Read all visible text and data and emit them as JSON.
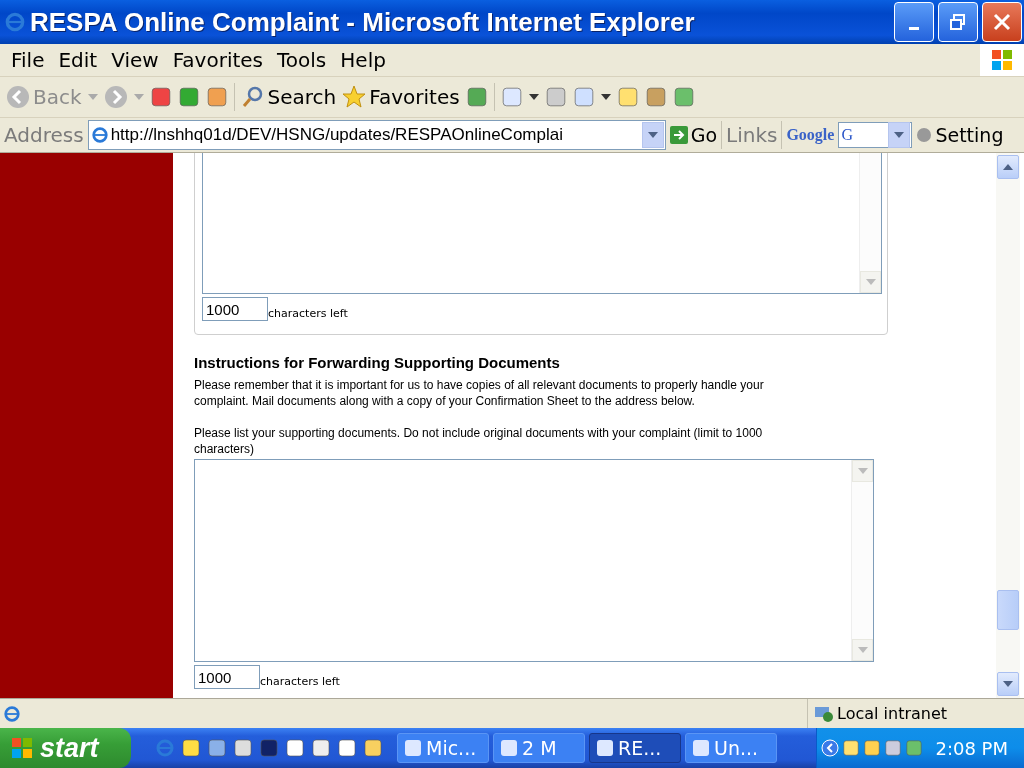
{
  "window": {
    "title": "RESPA Online Complaint - Microsoft Internet Explorer"
  },
  "menu": [
    "File",
    "Edit",
    "View",
    "Favorites",
    "Tools",
    "Help"
  ],
  "toolbar": {
    "back": "Back",
    "back_disabled": true,
    "search": "Search",
    "favorites": "Favorites"
  },
  "address": {
    "label": "Address",
    "value": "http://lnshhq01d/DEV/HSNG/updates/RESPAOnlineComplai",
    "go": "Go",
    "links": "Links",
    "google": "Google",
    "google_box": "G",
    "settings": "Setting"
  },
  "form": {
    "first_counter": {
      "value": "1000",
      "label": "characters left"
    },
    "heading": "Instructions for Forwarding Supporting Documents",
    "paragraphs": [
      "Please remember that it is important for us to have copies of all relevant documents to properly handle your complaint. Mail documents along with a copy of your Confirmation Sheet to the address below.",
      "Please list your supporting documents. Do not include original documents with your complaint (limit to 1000 characters)"
    ],
    "second_counter": {
      "value": "1000",
      "label": "characters left"
    }
  },
  "status_bar": {
    "zone": "Local intranet"
  },
  "taskbar": {
    "start": "start",
    "tasks": [
      {
        "label": "Mic...",
        "selected": false
      },
      {
        "label": "2 M",
        "selected": false
      },
      {
        "label": "RE...",
        "selected": true
      },
      {
        "label": "Un...",
        "selected": false
      }
    ],
    "clock": "2:08 PM"
  }
}
